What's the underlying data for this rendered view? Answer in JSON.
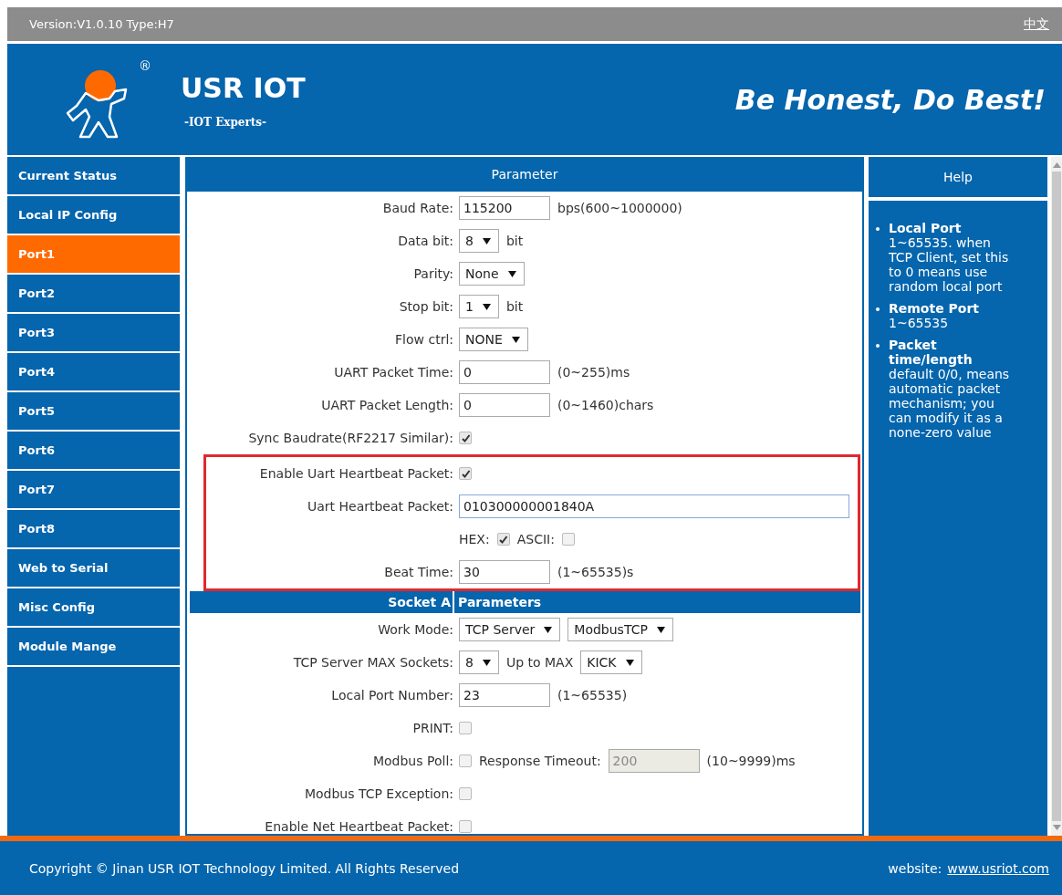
{
  "top_bar": {
    "version": "Version:V1.0.10 Type:H7",
    "language_link": "中文"
  },
  "header": {
    "logo_mark": "®",
    "brand": "USR IOT",
    "subtitle": "-IOT Experts-",
    "slogan": "Be Honest, Do Best!"
  },
  "sidebar": {
    "items": [
      {
        "label": "Current Status",
        "selected": false
      },
      {
        "label": "Local IP Config",
        "selected": false
      },
      {
        "label": "Port1",
        "selected": true
      },
      {
        "label": "Port2",
        "selected": false
      },
      {
        "label": "Port3",
        "selected": false
      },
      {
        "label": "Port4",
        "selected": false
      },
      {
        "label": "Port5",
        "selected": false
      },
      {
        "label": "Port6",
        "selected": false
      },
      {
        "label": "Port7",
        "selected": false
      },
      {
        "label": "Port8",
        "selected": false
      },
      {
        "label": "Web to Serial",
        "selected": false
      },
      {
        "label": "Misc Config",
        "selected": false
      },
      {
        "label": "Module Mange",
        "selected": false
      }
    ]
  },
  "parameter_panel": {
    "title": "Parameter",
    "sections": [
      {
        "kind": "rows",
        "highlighted": false,
        "rows": [
          {
            "label": "Baud Rate:",
            "controls": [
              {
                "kind": "input",
                "value": "115200",
                "disabled": false
              },
              {
                "kind": "text",
                "text": "bps(600~1000000)"
              }
            ]
          },
          {
            "label": "Data bit:",
            "controls": [
              {
                "kind": "select",
                "value": "8"
              },
              {
                "kind": "text",
                "text": "bit"
              }
            ]
          },
          {
            "label": "Parity:",
            "controls": [
              {
                "kind": "select",
                "value": "None"
              }
            ]
          },
          {
            "label": "Stop bit:",
            "controls": [
              {
                "kind": "select",
                "value": "1"
              },
              {
                "kind": "text",
                "text": "bit"
              }
            ]
          },
          {
            "label": "Flow ctrl:",
            "controls": [
              {
                "kind": "select",
                "value": "NONE"
              }
            ]
          },
          {
            "label": "UART Packet Time:",
            "controls": [
              {
                "kind": "input",
                "value": "0",
                "disabled": false
              },
              {
                "kind": "text",
                "text": "(0~255)ms"
              }
            ]
          },
          {
            "label": "UART Packet Length:",
            "controls": [
              {
                "kind": "input",
                "value": "0",
                "disabled": false
              },
              {
                "kind": "text",
                "text": "(0~1460)chars"
              }
            ]
          },
          {
            "label": "Sync Baudrate(RF2217 Similar):",
            "controls": [
              {
                "kind": "checkbox",
                "checked": true
              }
            ]
          }
        ]
      },
      {
        "kind": "rows",
        "highlighted": true,
        "rows": [
          {
            "label": "Enable Uart Heartbeat Packet:",
            "controls": [
              {
                "kind": "checkbox",
                "checked": true
              }
            ]
          },
          {
            "label": "Uart Heartbeat Packet:",
            "controls": [
              {
                "kind": "longinput",
                "value": "010300000001840A",
                "disabled": false
              }
            ]
          },
          {
            "controls": [
              {
                "kind": "text",
                "text": "HEX:"
              },
              {
                "kind": "checkbox",
                "checked": true
              },
              {
                "kind": "text",
                "text": "ASCII:"
              },
              {
                "kind": "checkbox",
                "checked": false
              }
            ]
          },
          {
            "label": "Beat Time:",
            "controls": [
              {
                "kind": "input",
                "value": "30",
                "disabled": false
              },
              {
                "kind": "text",
                "text": "(1~65535)s"
              }
            ]
          }
        ]
      },
      {
        "kind": "heading",
        "left": "Socket A",
        "right": "Parameters"
      },
      {
        "kind": "rows",
        "highlighted": false,
        "rows": [
          {
            "label": "Work Mode:",
            "controls": [
              {
                "kind": "select",
                "value": "TCP Server"
              },
              {
                "kind": "select",
                "value": "ModbusTCP"
              }
            ]
          },
          {
            "label": "TCP Server MAX Sockets:",
            "controls": [
              {
                "kind": "select",
                "value": "8"
              },
              {
                "kind": "text",
                "text": "Up to MAX"
              },
              {
                "kind": "select",
                "value": "KICK"
              }
            ]
          },
          {
            "label": "Local Port Number:",
            "controls": [
              {
                "kind": "input",
                "value": "23",
                "disabled": false
              },
              {
                "kind": "text",
                "text": "(1~65535)"
              }
            ]
          },
          {
            "label": "PRINT:",
            "controls": [
              {
                "kind": "checkbox",
                "checked": false
              }
            ]
          },
          {
            "label": "Modbus Poll:",
            "controls": [
              {
                "kind": "checkbox",
                "checked": false
              },
              {
                "kind": "text",
                "text": "Response Timeout:"
              },
              {
                "kind": "input",
                "value": "200",
                "disabled": true
              },
              {
                "kind": "text",
                "text": "(10~9999)ms"
              }
            ]
          },
          {
            "label": "Modbus TCP Exception:",
            "controls": [
              {
                "kind": "checkbox",
                "checked": false
              }
            ]
          },
          {
            "label": "Enable Net Heartbeat Packet:",
            "controls": [
              {
                "kind": "checkbox",
                "checked": false
              }
            ]
          }
        ]
      }
    ]
  },
  "help_panel": {
    "title": "Help",
    "items": [
      {
        "title": "Local Port",
        "text": "1~65535. when TCP Client, set this to 0 means use random local port"
      },
      {
        "title": "Remote Port",
        "text": "1~65535"
      },
      {
        "title": "Packet time/length",
        "text": "default 0/0, means automatic packet mechanism; you can modify it as a none-zero value"
      }
    ]
  },
  "footer": {
    "copyright": "Copyright © Jinan USR IOT Technology Limited. All Rights Reserved",
    "website_label": "website:",
    "website_link": "www.usriot.com"
  }
}
